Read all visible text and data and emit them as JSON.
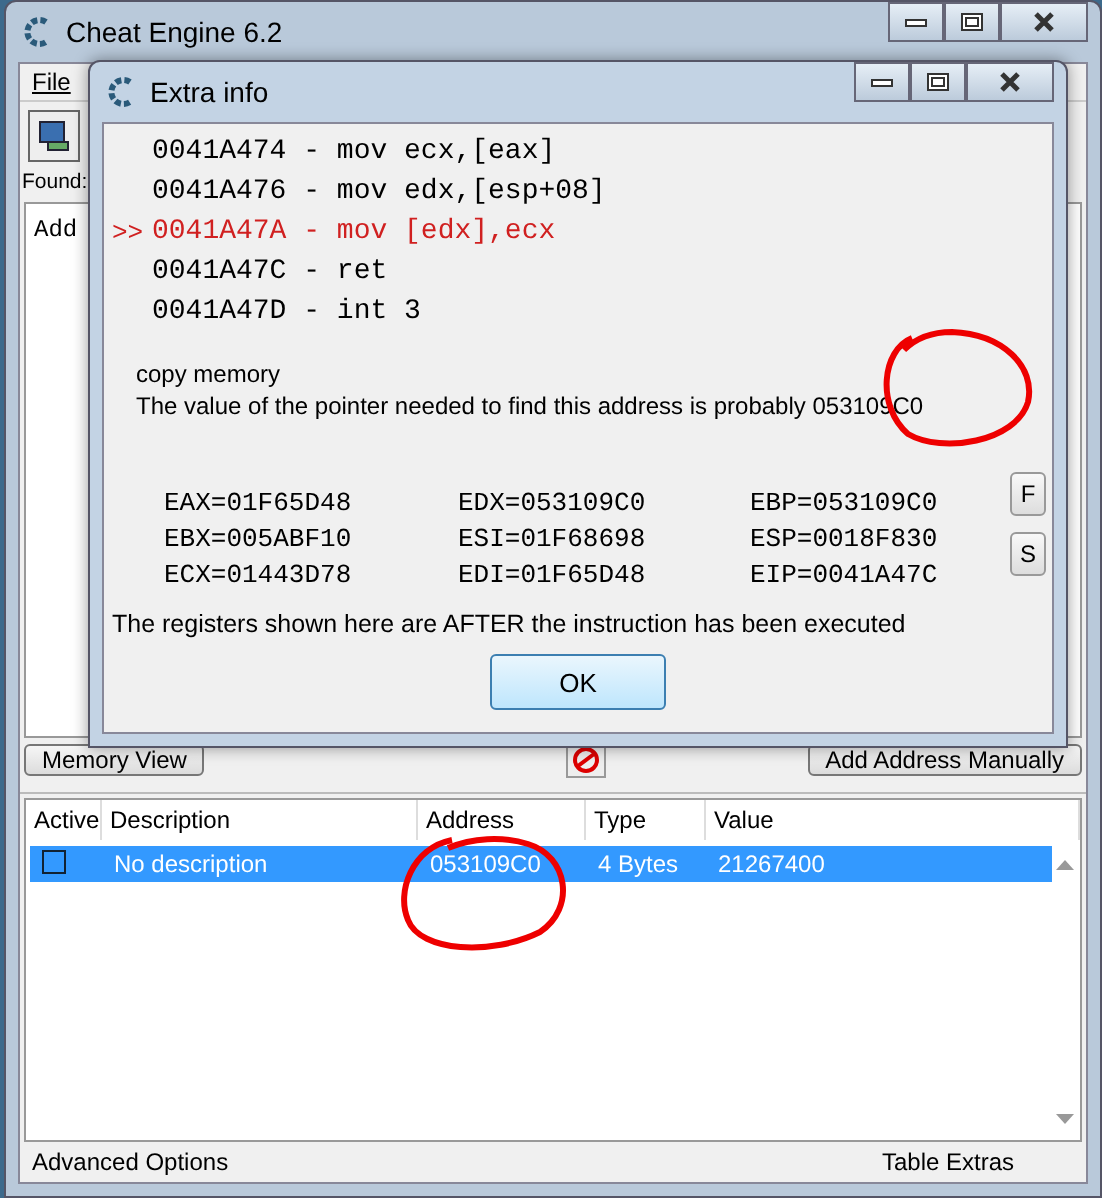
{
  "main_window": {
    "title": "Cheat Engine 6.2",
    "menu": [
      "File"
    ],
    "found_label": "Found:",
    "list_header": "Add",
    "memory_view_button": "Memory View",
    "add_address_button": "Add Address Manually",
    "table": {
      "columns": [
        "Active",
        "Description",
        "Address",
        "Type",
        "Value"
      ],
      "rows": [
        {
          "active": false,
          "selected": true,
          "description": "No description",
          "address": "053109C0",
          "type": "4 Bytes",
          "value": "21267400"
        }
      ]
    },
    "status_bar": [
      "Advanced Options",
      "Table Extras"
    ]
  },
  "dialog": {
    "title": "Extra info",
    "current_marker": ">>",
    "code_lines": [
      {
        "text": "0041A474 - mov ecx,[eax]",
        "selected": false
      },
      {
        "text": "0041A476 - mov edx,[esp+08]",
        "selected": false
      },
      {
        "text": "0041A47A - mov [edx],ecx",
        "selected": true
      },
      {
        "text": "0041A47C - ret",
        "selected": false
      },
      {
        "text": "0041A47D - int 3",
        "selected": false
      }
    ],
    "comment": "copy memory",
    "pointer_note": "The value of the pointer needed to find this address is probably 053109C0",
    "registers": [
      "EAX=01F65D48",
      "EDX=053109C0",
      "EBP=053109C0",
      "EBX=005ABF10",
      "ESI=01F68698",
      "ESP=0018F830",
      "ECX=01443D78",
      "EDI=01F65D48",
      "EIP=0041A47C"
    ],
    "side_buttons": [
      "F",
      "S"
    ],
    "after_note": "The registers shown here are AFTER the instruction has been executed",
    "ok_button": "OK"
  }
}
